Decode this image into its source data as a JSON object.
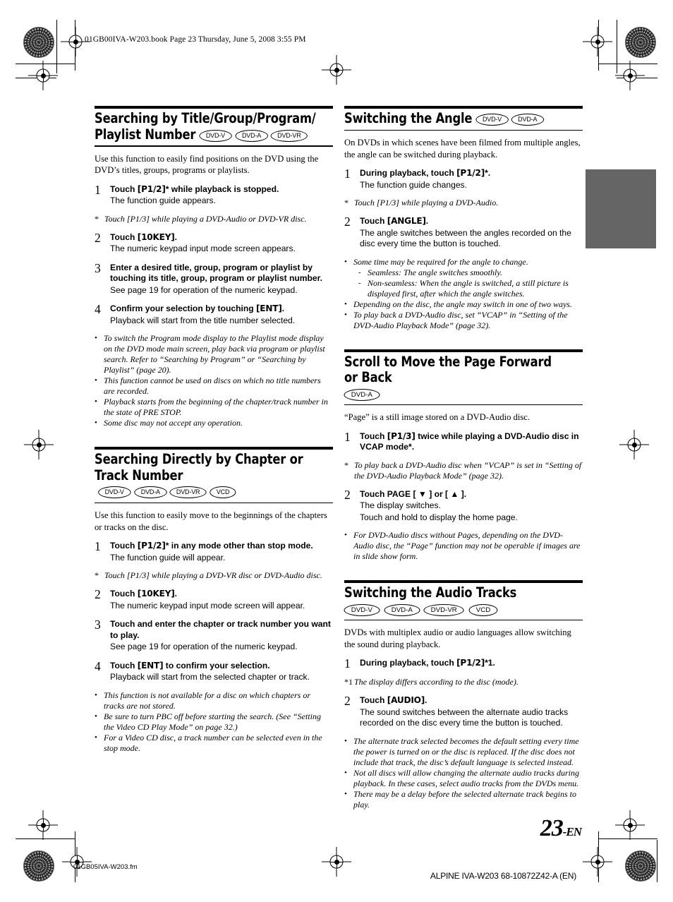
{
  "page": {
    "top_slug": "01GB00IVA-W203.book  Page 23  Thursday, June 5, 2008  3:55 PM",
    "page_number": "23",
    "page_number_suffix": "-EN",
    "footer_left": "01GB05IVA-W203.fm",
    "footer_right": "ALPINE IVA-W203 68-10872Z42-A (EN)",
    "tab_color": "#646464"
  },
  "left_column": {
    "sections": [
      {
        "title": "Searching by Title/Group/Program/ Playlist Number",
        "badges": [
          "DVD-V",
          "DVD-A",
          "DVD-VR"
        ],
        "badges_inline": true,
        "lead": "Use this function to easily find positions on the DVD using the DVD’s titles, groups, programs or playlists.",
        "steps": [
          {
            "num": "1",
            "head_prefix": "Touch ",
            "head_key": "[P1/2]",
            "head_suffix": "* while playback is stopped.",
            "sub": "The function guide appears."
          },
          {
            "num": "2",
            "head_prefix": "Touch ",
            "head_key": "[10KEY]",
            "head_suffix": ".",
            "sub": "The numeric keypad input mode screen appears."
          },
          {
            "num": "3",
            "head_prefix": "Enter a desired title, group, program or playlist by touching its title, group, program or playlist number.",
            "head_key": "",
            "head_suffix": "",
            "sub": "See page 19 for operation of the numeric keypad."
          },
          {
            "num": "4",
            "head_prefix": "Confirm your selection by touching ",
            "head_key": "[ENT]",
            "head_suffix": ".",
            "sub": "Playback will start from the title number selected."
          }
        ],
        "footnote": {
          "mark": "*",
          "text": "Touch [P1/3] while playing a DVD-Audio or DVD-VR disc."
        },
        "footnote_after_step": 0,
        "bullets": [
          "To switch the Program mode display to the Playlist mode display on the DVD mode main screen, play back via program or playlist search. Refer to “Searching by Program” or “Searching by Playlist” (page 20).",
          "This function cannot be used on discs on which no title numbers are recorded.",
          "Playback starts from the beginning of the chapter/track number in the state of PRE STOP.",
          "Some disc may not accept any operation."
        ]
      },
      {
        "title": "Searching Directly by Chapter or Track Number",
        "badges": [
          "DVD-V",
          "DVD-A",
          "DVD-VR",
          "VCD"
        ],
        "badges_inline": true,
        "lead": "Use this function to easily move to the beginnings of the chapters or tracks on the disc.",
        "steps": [
          {
            "num": "1",
            "head_prefix": "Touch ",
            "head_key": "[P1/2]",
            "head_suffix": "* in any mode other than stop mode.",
            "sub": "The function guide will appear."
          },
          {
            "num": "2",
            "head_prefix": "Touch ",
            "head_key": "[10KEY]",
            "head_suffix": ".",
            "sub": "The numeric keypad input mode screen will appear."
          },
          {
            "num": "3",
            "head_prefix": "Touch and enter the chapter or track number you want to play.",
            "head_key": "",
            "head_suffix": "",
            "sub": "See page 19 for operation of the numeric keypad."
          },
          {
            "num": "4",
            "head_prefix": "Touch ",
            "head_key": "[ENT]",
            "head_suffix": " to confirm your selection.",
            "sub": "Playback will start from the selected chapter or track."
          }
        ],
        "footnote": {
          "mark": "*",
          "text": "Touch [P1/3] while playing a DVD-VR disc or DVD-Audio disc."
        },
        "footnote_after_step": 0,
        "bullets": [
          "This function is not available for a disc on which chapters or tracks are not stored.",
          "Be sure to turn PBC off before starting the search. (See “Setting the Video CD Play Mode” on page 32.)",
          "For a Video CD disc, a track number can be selected even in the stop mode."
        ]
      }
    ]
  },
  "right_column": {
    "sections": [
      {
        "title": "Switching the Angle",
        "badges": [
          "DVD-V",
          "DVD-A"
        ],
        "badges_inline": true,
        "lead": "On DVDs in which scenes have been filmed from multiple angles, the angle can be switched during playback.",
        "steps": [
          {
            "num": "1",
            "head_prefix": "During playback, touch ",
            "head_key": "[P1/2]",
            "head_suffix": "*.",
            "sub": "The function guide changes."
          },
          {
            "num": "2",
            "head_prefix": "Touch ",
            "head_key": "[ANGLE]",
            "head_suffix": ".",
            "sub": "The angle switches between the angles recorded on the disc every time the button is touched."
          }
        ],
        "footnote": {
          "mark": "*",
          "text": "Touch [P1/3] while playing a DVD-Audio."
        },
        "footnote_after_step": 0,
        "bullets": [
          "Some time may be required for the angle to change.",
          "Depending on the disc, the angle may switch in one of two ways."
        ],
        "sub_bullets_after": 1,
        "sub_bullets": [
          "Seamless:  The angle switches smoothly.",
          "Non-seamless:  When the angle is switched, a still picture is displayed first, after which the angle switches."
        ],
        "bullets_tail": [
          "To play back a DVD-Audio disc, set “VCAP” in “Setting of the DVD-Audio Playback Mode” (page 32)."
        ]
      },
      {
        "title": "Scroll to Move the Page Forward or Back",
        "badges": [
          "DVD-A"
        ],
        "badges_inline": false,
        "lead": "“Page” is a still image stored on a DVD-Audio disc.",
        "steps": [
          {
            "num": "1",
            "head_prefix": "Touch ",
            "head_key": "[P1/3]",
            "head_suffix": " twice while playing a DVD-Audio disc in VCAP mode*.",
            "sub": ""
          },
          {
            "num": "2",
            "head_prefix": "Touch PAGE [ ▼ ] or [ ▲ ].",
            "head_key": "",
            "head_suffix": "",
            "sub": "The display switches.",
            "sub2": "Touch and hold to display the home page."
          }
        ],
        "footnote": {
          "mark": "*",
          "text": "To play back a DVD-Audio disc when “VCAP” is set in “Setting of the DVD-Audio Playback Mode” (page 32)."
        },
        "footnote_after_step": 0,
        "bullets": [
          "For DVD-Audio discs without Pages, depending on the DVD-Audio disc, the “Page” function may not be operable if images are in slide show form."
        ]
      },
      {
        "title": "Switching the Audio Tracks",
        "badges": [
          "DVD-V",
          "DVD-A",
          "DVD-VR",
          "VCD"
        ],
        "badges_inline": false,
        "lead": "DVDs with multiplex audio or audio languages allow switching the sound during playback.",
        "steps": [
          {
            "num": "1",
            "head_prefix": "During playback, touch ",
            "head_key": "[P1/2]",
            "head_suffix": "*1.",
            "sub": ""
          },
          {
            "num": "2",
            "head_prefix": "Touch ",
            "head_key": "[AUDIO]",
            "head_suffix": ".",
            "sub": "The sound switches between the alternate audio tracks recorded on the disc every time the button is touched."
          }
        ],
        "footnote": {
          "mark": "*1",
          "text": "The display differs according to the disc (mode)."
        },
        "footnote_after_step": 0,
        "bullets": [
          "The alternate track selected becomes the default setting every time the power is turned on or the disc is replaced. If the disc does not include that track, the disc’s default language is selected instead.",
          "Not all discs will allow changing the alternate audio tracks during playback. In these cases, select audio tracks from the DVDs menu.",
          "There may be a delay before the selected alternate track begins to play."
        ]
      }
    ]
  }
}
